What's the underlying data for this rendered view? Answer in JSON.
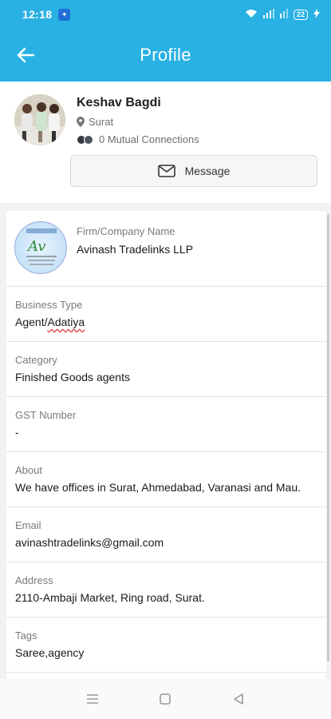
{
  "status_bar": {
    "time": "12:18",
    "battery": "22"
  },
  "app_bar": {
    "title": "Profile",
    "back_icon": "arrow-left-icon"
  },
  "profile": {
    "name": "Keshav Bagdi",
    "location": "Surat",
    "mutual_connections": "0 Mutual Connections",
    "message_label": "Message"
  },
  "details": {
    "firm": {
      "label": "Firm/Company Name",
      "value": "Avinash Tradelinks LLP"
    },
    "business_type": {
      "label": "Business Type",
      "value": "Agent/Adatiya"
    },
    "category": {
      "label": "Category",
      "value": "Finished Goods agents"
    },
    "gst": {
      "label": "GST Number",
      "value": "-"
    },
    "about": {
      "label": "About",
      "value": "We have offices in Surat, Ahmedabad, Varanasi and Mau."
    },
    "email": {
      "label": "Email",
      "value": "avinashtradelinks@gmail.com"
    },
    "address": {
      "label": "Address",
      "value": "2110-Ambaji Market, Ring road, Surat."
    },
    "tags": {
      "label": "Tags",
      "value": "Saree,agency"
    }
  },
  "colors": {
    "primary": "#29b1e3",
    "background": "#f2f2f2"
  }
}
